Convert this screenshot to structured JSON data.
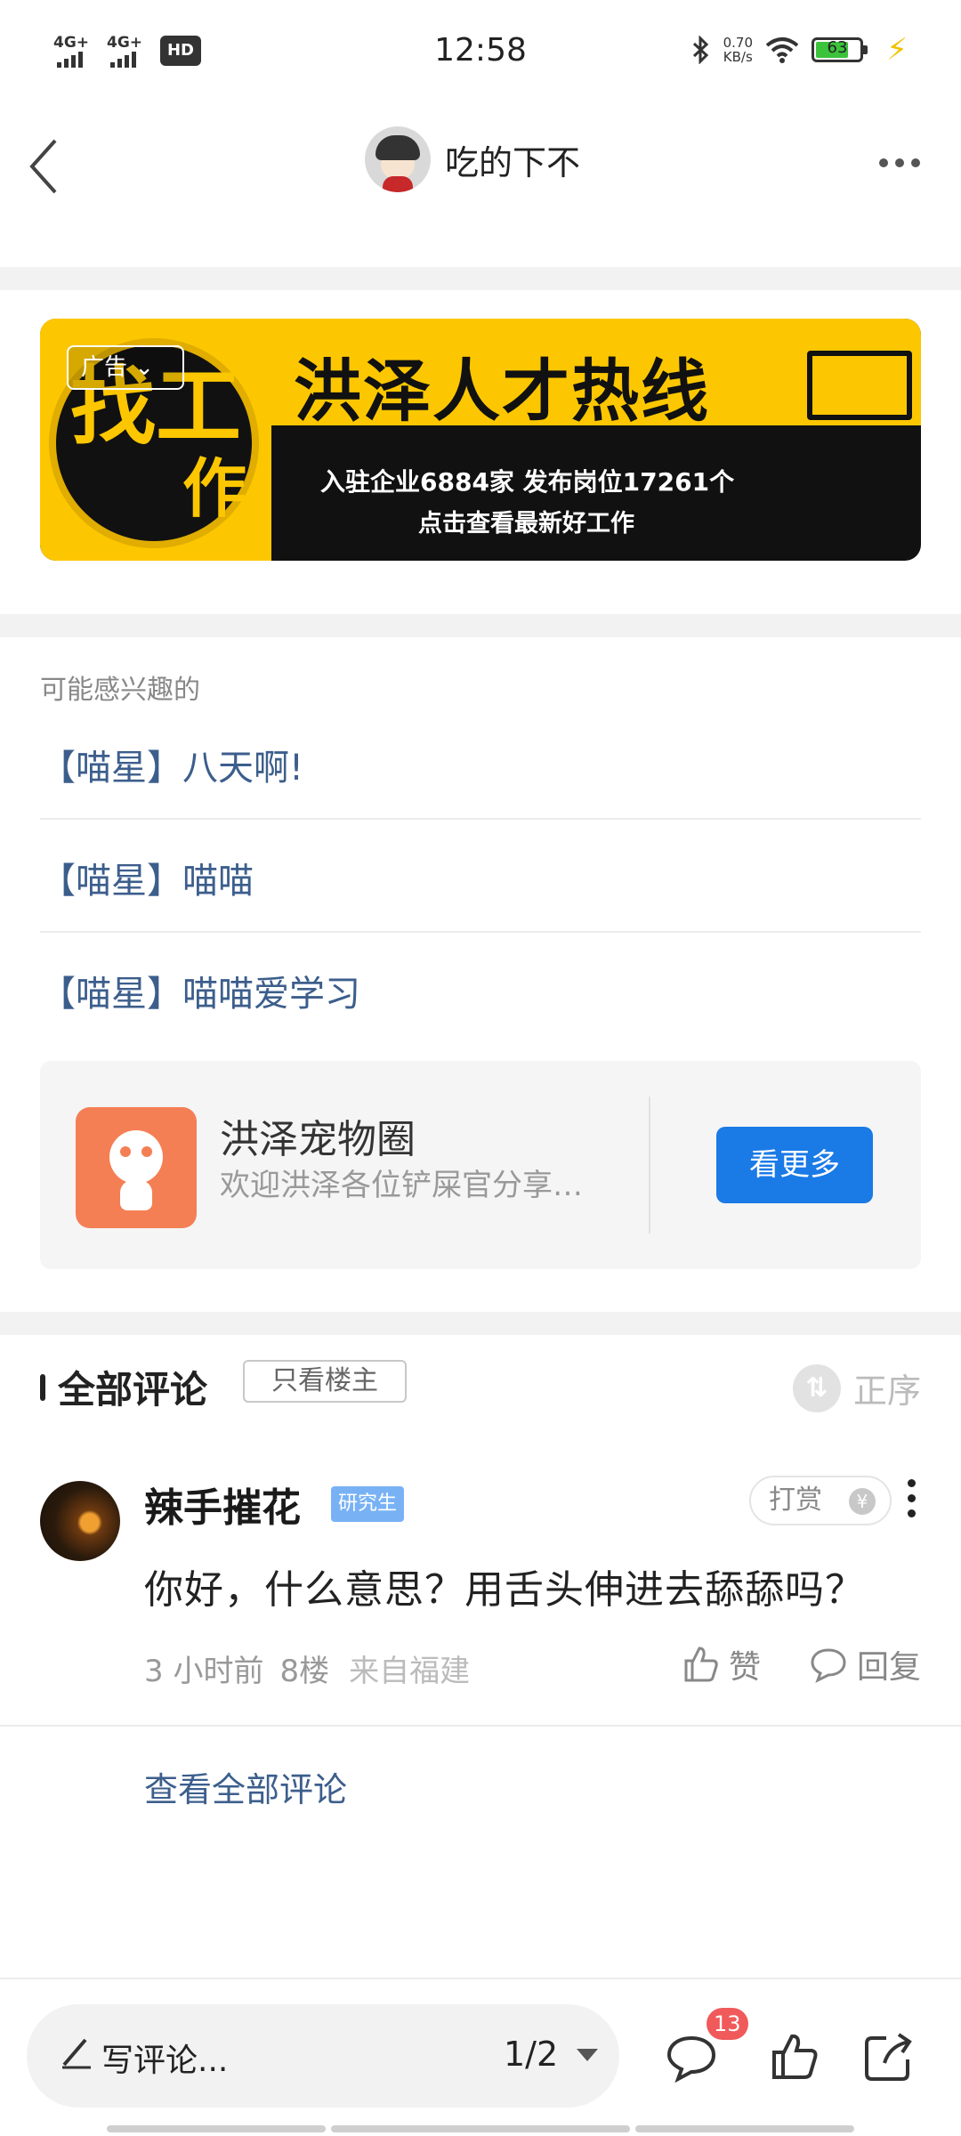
{
  "status_bar": {
    "time": "12:58",
    "signal1": "4G+",
    "signal2": "4G+",
    "hd": "HD",
    "net_speed_value": "0.70",
    "net_speed_unit": "KB/s",
    "battery": "63"
  },
  "header": {
    "title": "吃的下不"
  },
  "ad": {
    "tag": "广告",
    "circle_text_1": "找工",
    "circle_text_2": "作",
    "headline": "洪泽人才热线",
    "line1": "入驻企业6884家  发布岗位17261个",
    "line2": "点击查看最新好工作"
  },
  "recommend": {
    "heading": "可能感兴趣的",
    "items": [
      {
        "label": "【喵星】八天啊!"
      },
      {
        "label": "【喵星】喵喵"
      },
      {
        "label": "【喵星】喵喵爱学习"
      }
    ]
  },
  "forum": {
    "name": "洪泽宠物圈",
    "desc": "欢迎洪泽各位铲屎官分享…",
    "button": "看更多"
  },
  "comments": {
    "title": "全部评论",
    "only_op": "只看楼主",
    "order_label": "正序",
    "items": [
      {
        "user": "辣手摧花",
        "badge": "研究生",
        "tip": "打赏",
        "text": "你好，什么意思？用舌头伸进去舔舔吗？",
        "time": "3 小时前",
        "floor": "8楼",
        "location": "来自福建",
        "like": "赞",
        "reply": "回复"
      }
    ],
    "view_all": "查看全部评论"
  },
  "bottom_bar": {
    "placeholder": "写评论...",
    "page": "1/2",
    "comment_count": "13"
  },
  "colors": {
    "accent": "#1a7ae6",
    "link": "#3c5e8c",
    "ad_yellow": "#fcc700",
    "badge_red": "#f05a5a"
  }
}
